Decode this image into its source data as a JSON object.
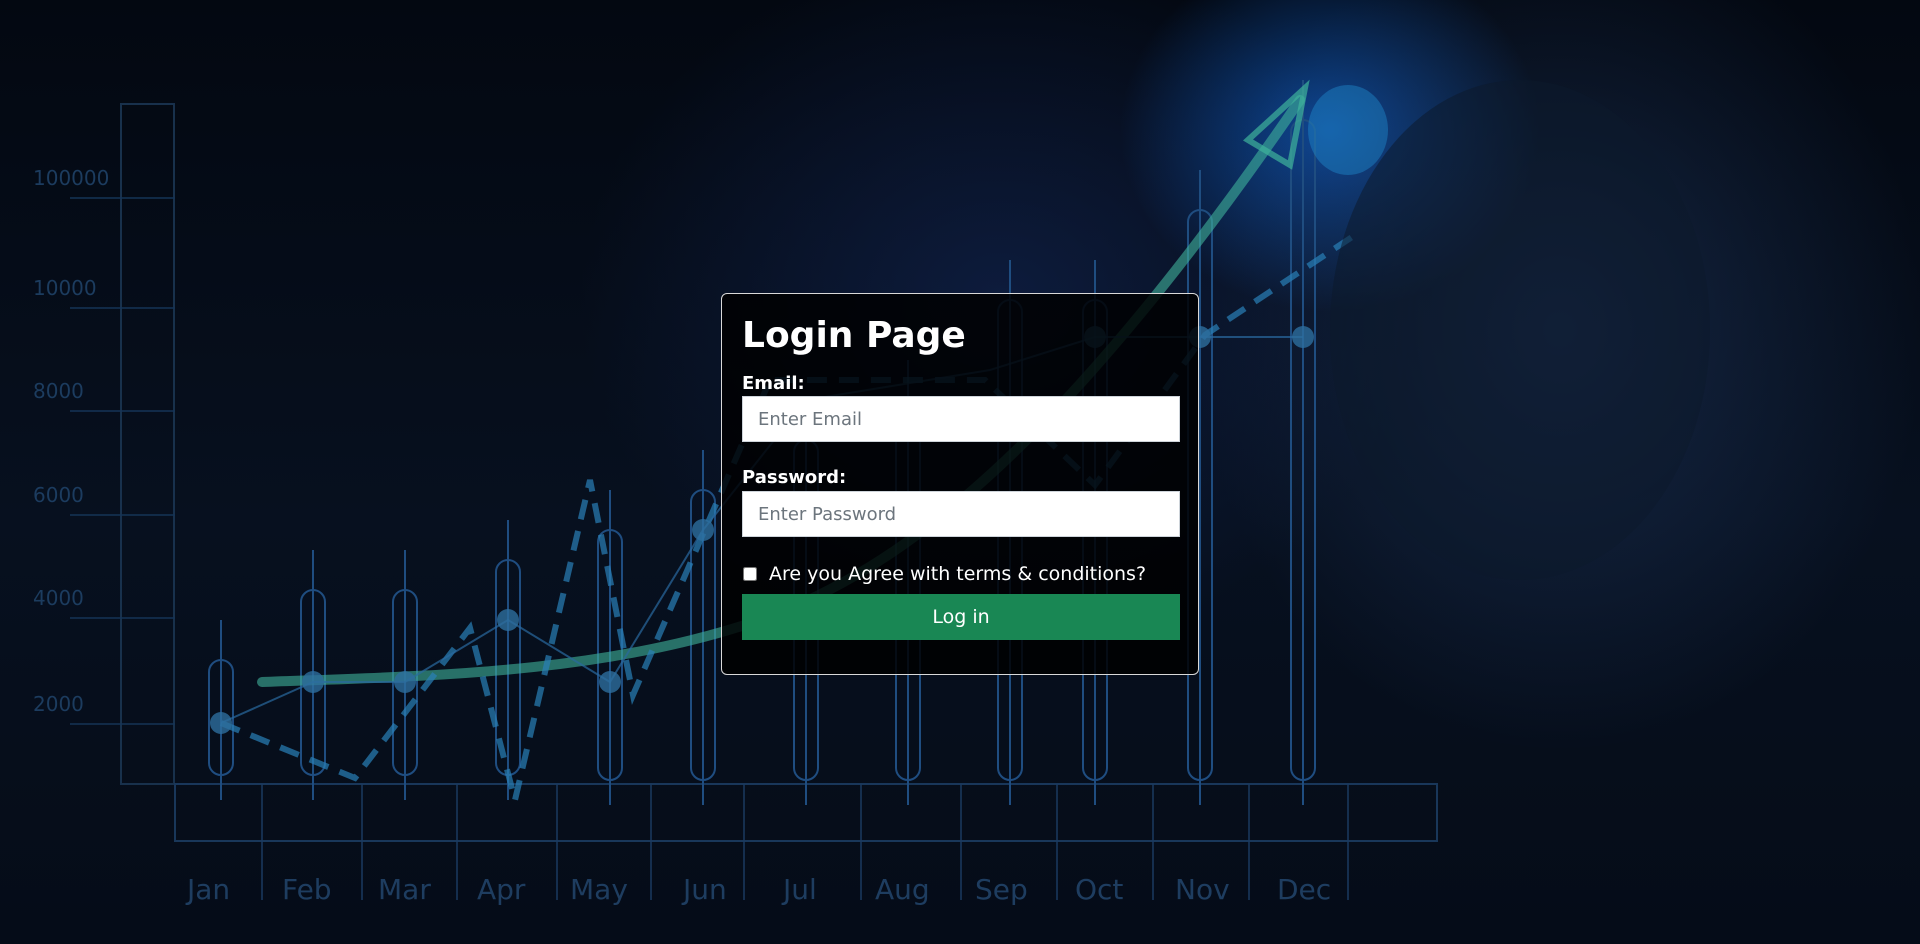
{
  "background": {
    "description_icon": "business-growth-chart-background",
    "y_tick_labels": [
      "100000",
      "10000",
      "8000",
      "6000",
      "4000",
      "2000"
    ],
    "x_tick_labels": [
      "Jan",
      "Feb",
      "Mar",
      "Apr",
      "May",
      "Jun",
      "Jul",
      "Aug",
      "Sep",
      "Oct",
      "Nov",
      "Dec"
    ]
  },
  "login": {
    "title": "Login Page",
    "email_label": "Email:",
    "email_placeholder": "Enter Email",
    "email_value": "",
    "password_label": "Password:",
    "password_placeholder": "Enter Password",
    "password_value": "",
    "terms_label": "Are you Agree with terms & conditions?",
    "terms_checked": false,
    "submit_label": "Log in"
  },
  "colors": {
    "button": "#198754",
    "card_border": "#d9d9d9",
    "accent_glow": "#1e6bff"
  }
}
